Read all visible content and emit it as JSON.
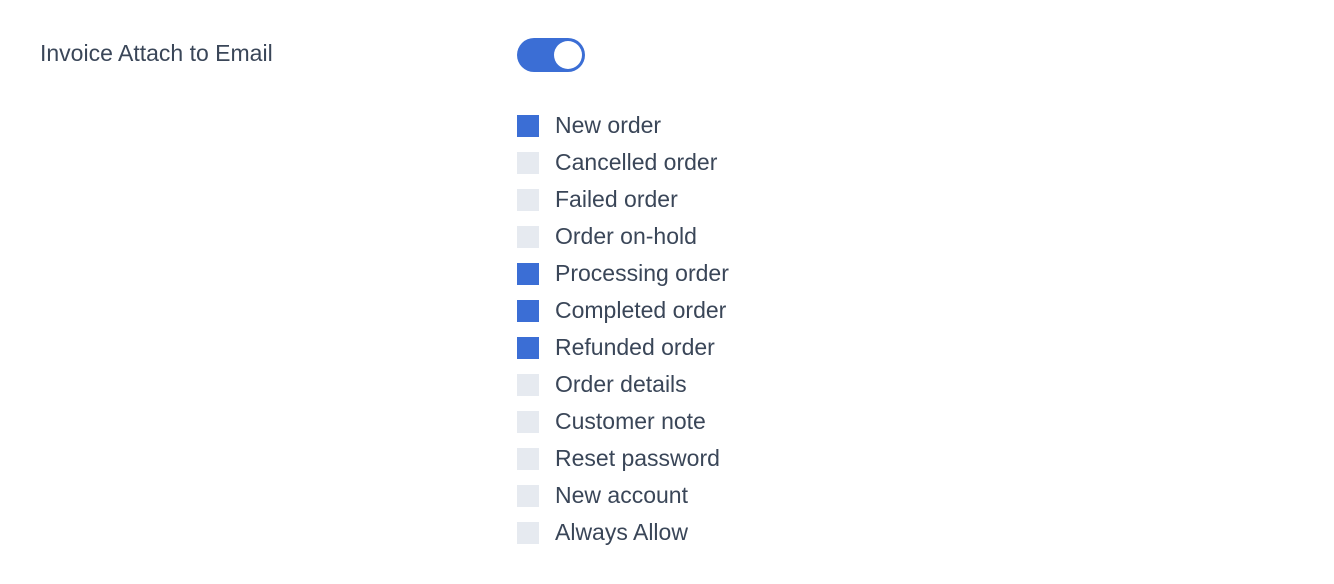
{
  "settings": {
    "invoice_attach": {
      "label": "Invoice Attach to Email",
      "enabled": true,
      "options": [
        {
          "label": "New order",
          "checked": true
        },
        {
          "label": "Cancelled order",
          "checked": false
        },
        {
          "label": "Failed order",
          "checked": false
        },
        {
          "label": "Order on-hold",
          "checked": false
        },
        {
          "label": "Processing order",
          "checked": true
        },
        {
          "label": "Completed order",
          "checked": true
        },
        {
          "label": "Refunded order",
          "checked": true
        },
        {
          "label": "Order details",
          "checked": false
        },
        {
          "label": "Customer note",
          "checked": false
        },
        {
          "label": "Reset password",
          "checked": false
        },
        {
          "label": "New account",
          "checked": false
        },
        {
          "label": "Always Allow",
          "checked": false
        }
      ]
    }
  }
}
